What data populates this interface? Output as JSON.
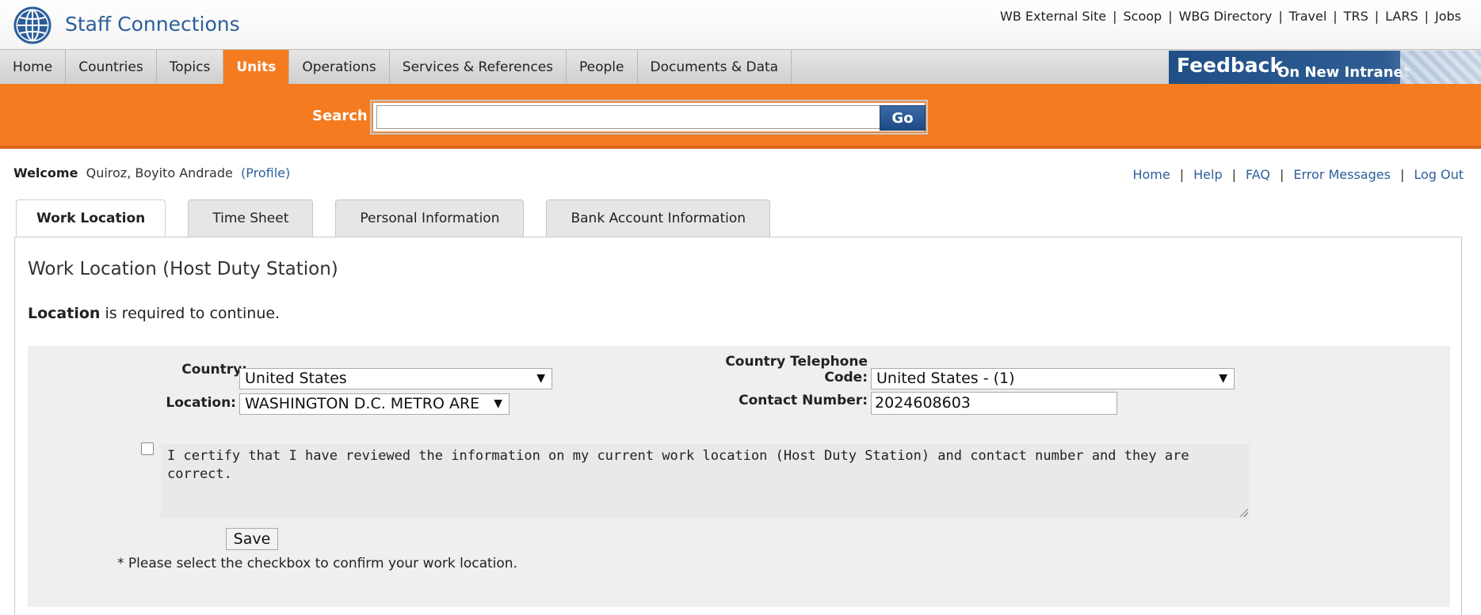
{
  "header": {
    "brand": "Staff Connections",
    "links": [
      "WB External Site",
      "Scoop",
      "WBG Directory",
      "Travel",
      "TRS",
      "LARS",
      "Jobs"
    ],
    "separator": "|"
  },
  "nav": {
    "items": [
      {
        "label": "Home"
      },
      {
        "label": "Countries"
      },
      {
        "label": "Topics"
      },
      {
        "label": "Units",
        "active": true
      },
      {
        "label": "Operations"
      },
      {
        "label": "Services & References"
      },
      {
        "label": "People"
      },
      {
        "label": "Documents & Data"
      }
    ],
    "feedback_big": "Feedback",
    "feedback_small": "On New Intranet"
  },
  "search": {
    "label": "Search",
    "value": "",
    "go_label": "Go"
  },
  "welcome": {
    "label": "Welcome",
    "user": "Quiroz, Boyito Andrade",
    "profile_link": "(Profile)"
  },
  "userlinks": [
    "Home",
    "Help",
    "FAQ",
    "Error Messages",
    "Log Out"
  ],
  "tabs": [
    {
      "label": "Work Location",
      "active": true
    },
    {
      "label": "Time Sheet"
    },
    {
      "label": "Personal Information"
    },
    {
      "label": "Bank Account Information"
    }
  ],
  "panel": {
    "title": "Work Location (Host Duty Station)",
    "required_bold": "Location",
    "required_rest": " is required to continue."
  },
  "form": {
    "country_label": "Country:",
    "country_value": "United States",
    "location_label": "Location:",
    "location_value": "WASHINGTON D.C. METRO ARE",
    "phone_code_label_line1": "Country Telephone",
    "phone_code_label_line2": "Code:",
    "phone_code_value": "United States - (1)",
    "contact_label": "Contact Number:",
    "contact_value": "2024608603",
    "certify_checked": false,
    "certify_text": "I certify that I have reviewed the information on my current work location (Host Duty Station) and contact number and they are correct.",
    "save_label": "Save",
    "note": "* Please select the checkbox to confirm your work location."
  },
  "colors": {
    "accent_orange": "#f47b20",
    "link_blue": "#2c5f9a",
    "go_blue": "#1d4a85"
  }
}
